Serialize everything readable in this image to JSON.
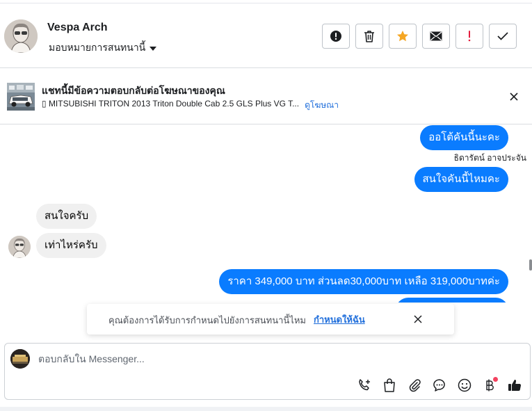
{
  "header": {
    "contact_name": "Vespa Arch",
    "assign_label": "มอบหมายการสนทนานี้",
    "actions": [
      {
        "name": "report-spam-button",
        "icon": "alert-circle-icon"
      },
      {
        "name": "delete-button",
        "icon": "trash-icon"
      },
      {
        "name": "star-button",
        "icon": "star-icon"
      },
      {
        "name": "mark-unread-button",
        "icon": "envelope-icon"
      },
      {
        "name": "follow-up-button",
        "icon": "exclamation-icon"
      },
      {
        "name": "mark-done-button",
        "icon": "check-icon"
      }
    ]
  },
  "ad_banner": {
    "title": "แชทนี้มีข้อความตอบกลับต่อโฆษณาของคุณ",
    "listing": "▯ MITSUBISHI TRITON 2013 Triton Double Cab 2.5 GLS Plus VG T...",
    "view_ad": "ดูโฆษณา"
  },
  "messages": {
    "out_1": "ออโต้คันนี้นะคะ",
    "sender_name": "ธิดารัตน์ อาจประจัน",
    "out_2": "สนใจคันนี้ไหมคะ",
    "in_1": "สนใจครับ",
    "in_2": "เท่าไหร่ครับ",
    "out_3": "ราคา 349,000 บาท ส่วนลด30,000บาท เหลือ 319,000บาทค่ะ"
  },
  "toast": {
    "text": "คุณต้องการได้รับการกำหนดไปยังการสนทนานี้ไหม",
    "link": "กำหนดให้ฉัน"
  },
  "composer": {
    "placeholder": "ตอบกลับใน Messenger...",
    "value": "",
    "tools": [
      "call-add-icon",
      "shopping-bag-icon",
      "paperclip-icon",
      "chat-bubble-icon",
      "emoji-icon",
      "baht-icon",
      "thumbs-up-icon"
    ]
  },
  "colors": {
    "accent": "#0a7cff",
    "link": "#216fdb",
    "star": "#f5a623",
    "alert_red": "#e41e3f",
    "badge": "#f3425f"
  }
}
